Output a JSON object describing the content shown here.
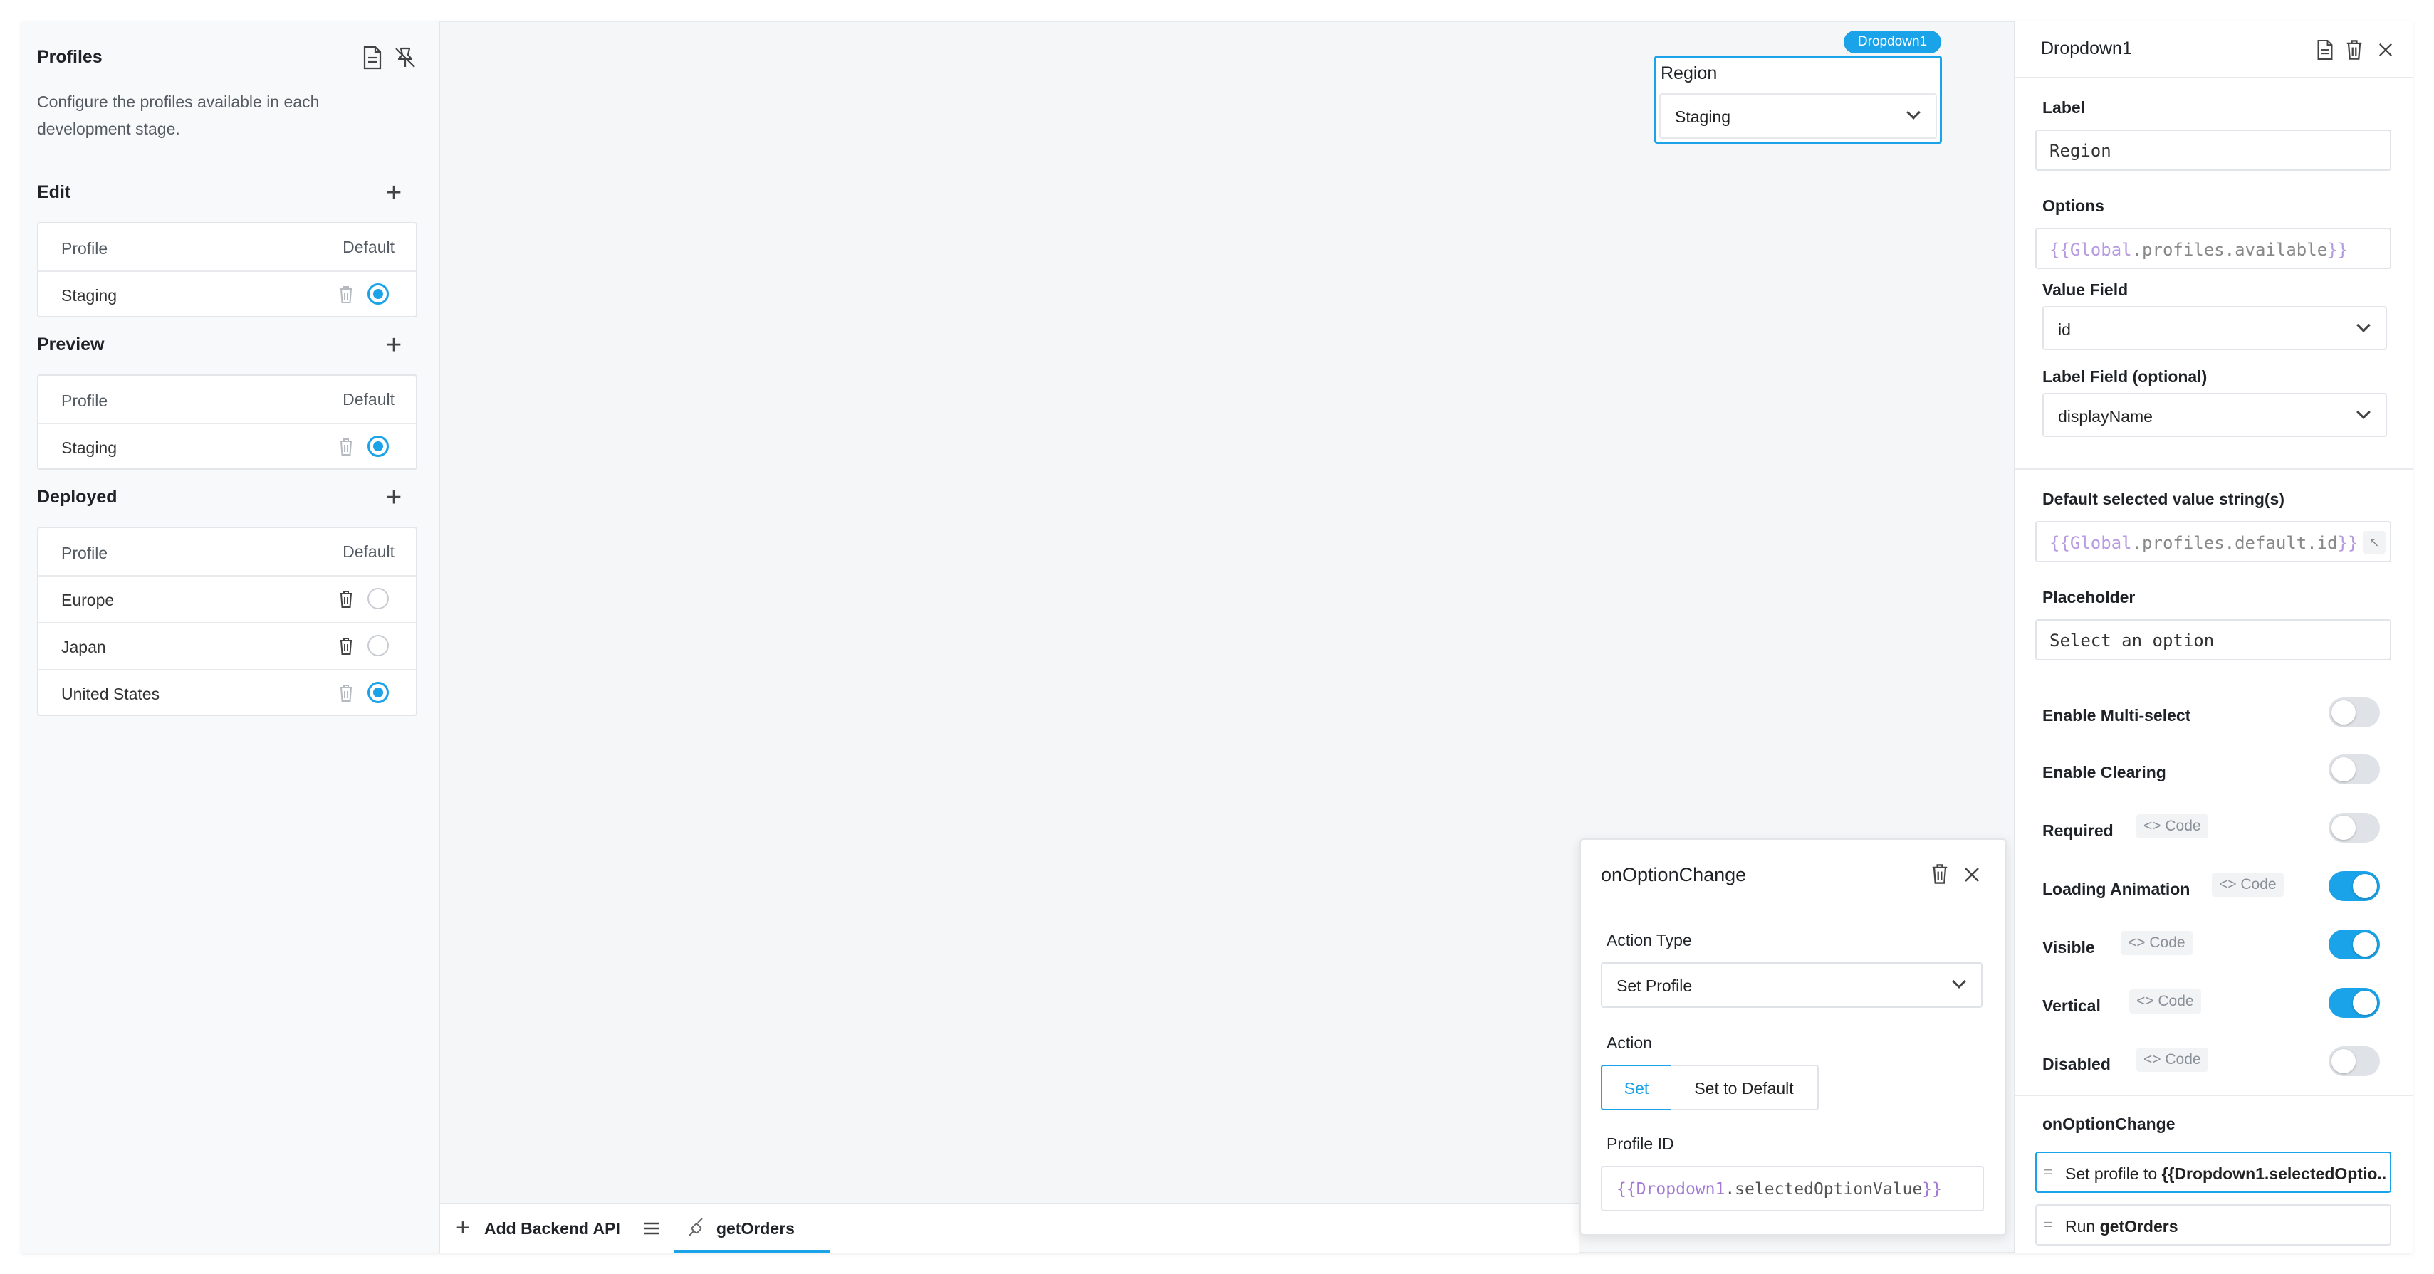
{
  "left_panel": {
    "title": "Profiles",
    "description_line1": "Configure the profiles available in each",
    "description_line2": "development stage.",
    "sections": [
      {
        "title": "Edit",
        "header_profile": "Profile",
        "header_default": "Default",
        "rows": [
          {
            "name": "Staging",
            "default": true
          }
        ]
      },
      {
        "title": "Preview",
        "header_profile": "Profile",
        "header_default": "Default",
        "rows": [
          {
            "name": "Staging",
            "default": true
          }
        ]
      },
      {
        "title": "Deployed",
        "header_profile": "Profile",
        "header_default": "Default",
        "rows": [
          {
            "name": "Europe",
            "default": false
          },
          {
            "name": "Japan",
            "default": false
          },
          {
            "name": "United States",
            "default": true
          }
        ]
      }
    ]
  },
  "canvas": {
    "widget_badge": "Dropdown1",
    "widget_label": "Region",
    "widget_value": "Staging"
  },
  "bottom_bar": {
    "add_label": "Add Backend API",
    "active_tab": "getOrders"
  },
  "popup": {
    "title": "onOptionChange",
    "action_type_label": "Action Type",
    "action_type_value": "Set Profile",
    "action_label": "Action",
    "action_options": [
      "Set",
      "Set to Default"
    ],
    "action_selected": "Set",
    "profile_id_label": "Profile ID",
    "profile_id_value_open": "{{",
    "profile_id_value_obj": "Dropdown1",
    "profile_id_value_rest": ".selectedOptionValue",
    "profile_id_value_close": "}}"
  },
  "right_panel": {
    "title": "Dropdown1",
    "label_label": "Label",
    "label_value": "Region",
    "options_label": "Options",
    "options_open": "{{",
    "options_obj": "Global",
    "options_rest": ".profiles.available",
    "options_close": "}}",
    "value_field_label": "Value Field",
    "value_field_value": "id",
    "label_field_label": "Label Field (optional)",
    "label_field_value": "displayName",
    "default_label": "Default selected value string(s)",
    "default_open": "{{",
    "default_obj": "Global",
    "default_rest": ".profiles.default.id",
    "default_close": "}}",
    "placeholder_label": "Placeholder",
    "placeholder_value": "Select an option",
    "toggles": [
      {
        "label": "Enable Multi-select",
        "code": "",
        "on": false
      },
      {
        "label": "Enable Clearing",
        "code": "",
        "on": false
      },
      {
        "label": "Required",
        "code": "Code",
        "on": false
      },
      {
        "label": "Loading Animation",
        "code": "Code",
        "on": true
      },
      {
        "label": "Visible",
        "code": "Code",
        "on": true
      },
      {
        "label": "Vertical",
        "code": "Code",
        "on": true
      },
      {
        "label": "Disabled",
        "code": "Code",
        "on": false
      }
    ],
    "event_label": "onOptionChange",
    "event_items": [
      {
        "prefix": "Set profile to ",
        "bold": "{{Dropdown1.selectedOptio..."
      },
      {
        "prefix": "Run ",
        "bold": "getOrders"
      }
    ]
  },
  "colors": {
    "accent": "#1aa3e8",
    "template_purple": "#a07ad6"
  }
}
